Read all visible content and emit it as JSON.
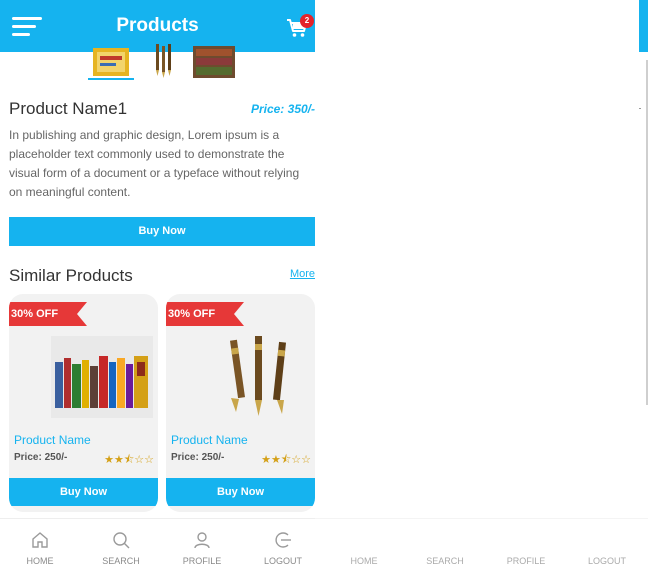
{
  "header": {
    "title": "Products",
    "cart_count": "2"
  },
  "product": {
    "name": "Product Name1",
    "price": "Price: 350/-",
    "description": "In publishing and graphic design, Lorem ipsum is a placeholder text commonly used to demonstrate the visual form of a document or a typeface without relying on meaningful content.",
    "buy_label": "Buy Now",
    "thumbnails": [
      "book-cover-thumbnail",
      "pens-thumbnail",
      "bookstore-thumbnail"
    ]
  },
  "similar": {
    "title": "Similar Products",
    "more_label": "More",
    "cards": [
      {
        "discount": "30% OFF",
        "name": "Product Name",
        "price": "Price: 250/-",
        "rating": 2.5,
        "buy_label": "Buy Now",
        "image": "books-image"
      },
      {
        "discount": "30% OFF",
        "name": "Product Name",
        "price": "Price: 250/-",
        "rating": 2.5,
        "buy_label": "Buy Now",
        "image": "pens-image"
      }
    ]
  },
  "bottom_nav": [
    {
      "label": "HOME",
      "icon": "home-icon"
    },
    {
      "label": "SEARCH",
      "icon": "search-icon"
    },
    {
      "label": "PROFILE",
      "icon": "profile-icon"
    },
    {
      "label": "LOGOUT",
      "icon": "logout-icon"
    }
  ],
  "colors": {
    "accent": "#15b3ef",
    "ribbon": "#e63838",
    "star": "#d4a017"
  }
}
